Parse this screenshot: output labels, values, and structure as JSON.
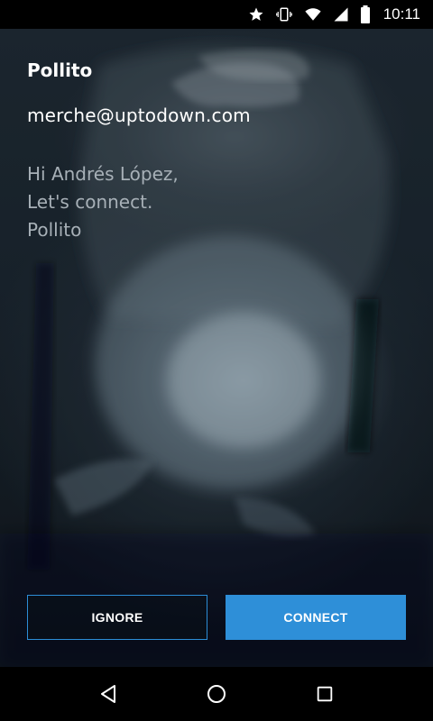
{
  "status_bar": {
    "time": "10:11",
    "icons": [
      "star-icon",
      "vibrate-icon",
      "wifi-icon",
      "signal-icon",
      "battery-icon"
    ]
  },
  "invite": {
    "name": "Pollito",
    "email": "merche@uptodown.com",
    "message_lines": [
      "Hi Andrés López,",
      "Let's connect.",
      "Pollito"
    ]
  },
  "buttons": {
    "ignore_label": "IGNORE",
    "connect_label": "CONNECT"
  },
  "nav_bar": {
    "icons": [
      "back-icon",
      "home-icon",
      "recents-icon"
    ]
  },
  "colors": {
    "accent": "#2e8fd8",
    "message_text": "#a7b0b7",
    "background": "#1b252e"
  }
}
